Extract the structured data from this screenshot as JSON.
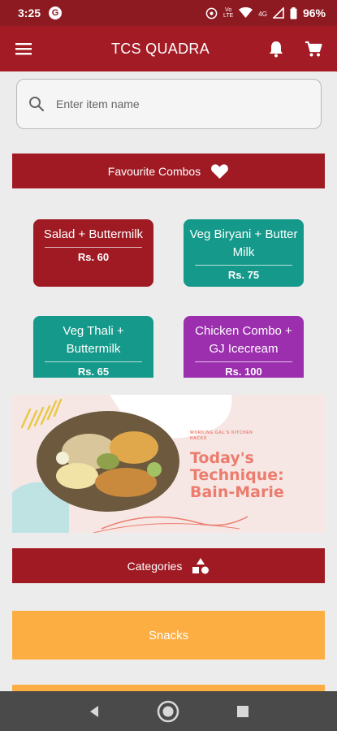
{
  "status_bar": {
    "time": "3:25",
    "app_badge": "G",
    "network_label_top": "Vo",
    "network_label_bottom": "LTE",
    "signal_label": "4G",
    "battery": "96%"
  },
  "app_bar": {
    "title": "TCS QUADRA",
    "menu_icon": "hamburger-menu-icon",
    "bell_icon": "bell-icon",
    "cart_icon": "cart-icon"
  },
  "search": {
    "placeholder": "Enter item name",
    "value": ""
  },
  "favourites": {
    "label": "Favourite Combos",
    "icon": "heart-icon",
    "combos": [
      {
        "name": "Salad + Buttermilk",
        "price": "Rs. 60",
        "color": "#a01a23"
      },
      {
        "name": "Veg Biryani + Butter Milk",
        "price": "Rs. 75",
        "color": "#15998a"
      },
      {
        "name": "Veg Thali + Buttermilk",
        "price": "Rs. 65",
        "color": "#15998a"
      },
      {
        "name": "Chicken Combo + GJ Icecream",
        "price": "Rs. 100",
        "color": "#9b2fae"
      }
    ]
  },
  "banner": {
    "tagline": "WORKING GAL'S KITCHEN HACKS",
    "title": "Today's Technique: Bain-Marie"
  },
  "categories": {
    "label": "Categories",
    "icon": "shapes-icon",
    "items": [
      {
        "label": "Snacks",
        "color": "#fdae42"
      },
      {
        "label": "",
        "color": "#fdae42"
      }
    ]
  },
  "colors": {
    "primary": "#a31b24",
    "teal": "#15998a",
    "purple": "#9b2fae",
    "orange": "#fdae42"
  }
}
